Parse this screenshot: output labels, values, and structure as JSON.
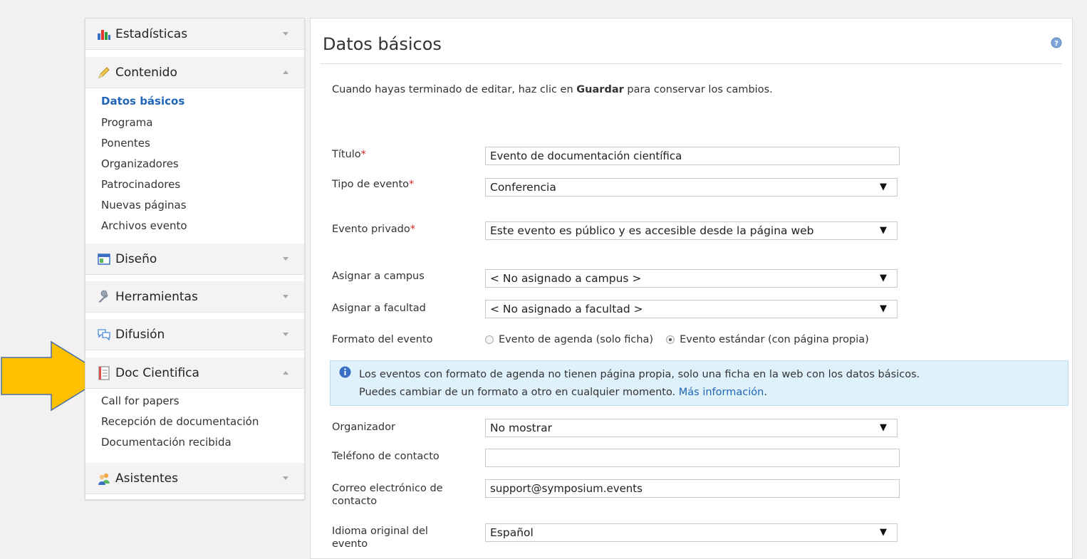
{
  "sidebar": {
    "estadisticas": "Estadísticas",
    "contenido": {
      "label": "Contenido",
      "items": [
        "Datos básicos",
        "Programa",
        "Ponentes",
        "Organizadores",
        "Patrocinadores",
        "Nuevas páginas",
        "Archivos evento"
      ]
    },
    "diseno": "Diseño",
    "herramientas": "Herramientas",
    "difusion": "Difusión",
    "doc_cientifica": {
      "label": "Doc Cientifica",
      "items": [
        "Call for papers",
        "Recepción de documentación",
        "Documentación recibida"
      ]
    },
    "asistentes": "Asistentes"
  },
  "main": {
    "title": "Datos básicos",
    "intro_prefix": "Cuando hayas terminado de editar, haz clic en ",
    "intro_bold": "Guardar",
    "intro_suffix": " para conservar los cambios.",
    "fields": {
      "titulo_label": "Título",
      "titulo_value": "Evento de documentación científica",
      "tipo_label": "Tipo de evento",
      "tipo_value": "Conferencia",
      "privado_label": "Evento privado",
      "privado_value": "Este evento es público y es accesible desde la página web",
      "campus_label": "Asignar a campus",
      "campus_value": "< No asignado a campus >",
      "facultad_label": "Asignar a facultad",
      "facultad_value": "< No asignado a facultad >",
      "formato_label": "Formato del evento",
      "formato_opt1": "Evento de agenda (solo ficha)",
      "formato_opt2": "Evento estándar (con página propia)",
      "organizador_label": "Organizador",
      "organizador_value": "No mostrar",
      "telefono_label": "Teléfono de contacto",
      "telefono_value": "",
      "correo_label_1": "Correo electrónico de",
      "correo_label_2": "contacto",
      "correo_value": "support@symposium.events",
      "idioma_label_1": "Idioma original del",
      "idioma_label_2": "evento",
      "idioma_value": "Español"
    },
    "required_mark": "*",
    "select_arrow": "▼",
    "info": {
      "line1": "Los eventos con formato de agenda no tienen página propia, solo una ficha en la web con los datos básicos.",
      "line2_prefix": "Puedes cambiar de un formato a otro en cualquier momento. ",
      "link": "Más información",
      "line2_suffix": "."
    }
  },
  "colors": {
    "accent_blue": "#1f66b8",
    "arrow_yellow": "#ffc000",
    "info_bg": "#dff1fb",
    "required_red": "#d9281f"
  }
}
